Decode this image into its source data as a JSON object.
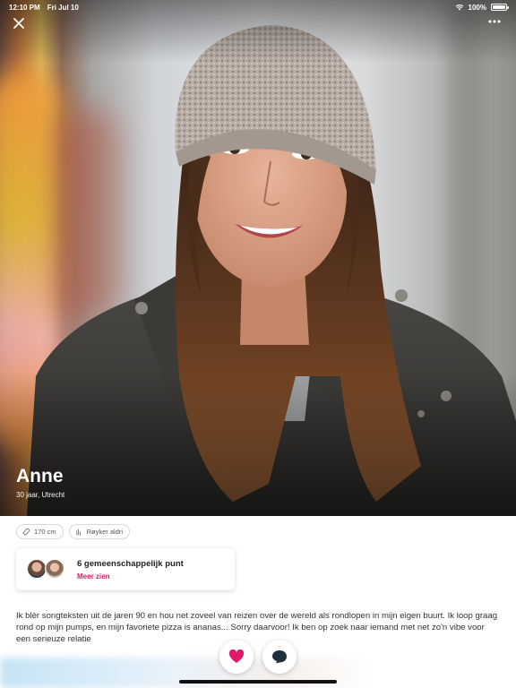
{
  "status_bar": {
    "time": "12:10 PM",
    "date": "Fri Jul 10",
    "battery": "100%"
  },
  "profile": {
    "name": "Anne",
    "subtitle": "30 jaar, Utrecht"
  },
  "tags": [
    {
      "icon": "ruler-icon",
      "label": "170 cm"
    },
    {
      "icon": "smoking-icon",
      "label": "Røyker aldri"
    }
  ],
  "common": {
    "title": "6 gemeenschappelijk punt",
    "link": "Meer zien"
  },
  "bio": "Ik blèr songteksten uit de jaren 90 en hou net zoveel van reizen over de wereld als rondlopen in mijn eigen buurt. Ik loop graag rond op mijn pumps, en mijn favoriete pizza is ananas... Sorry daarvoor! Ik ben op zoek naar iemand met net zo'n vibe voor een serieuze relatie",
  "colors": {
    "accent": "#e0196c",
    "chat": "#1f2f3c"
  }
}
